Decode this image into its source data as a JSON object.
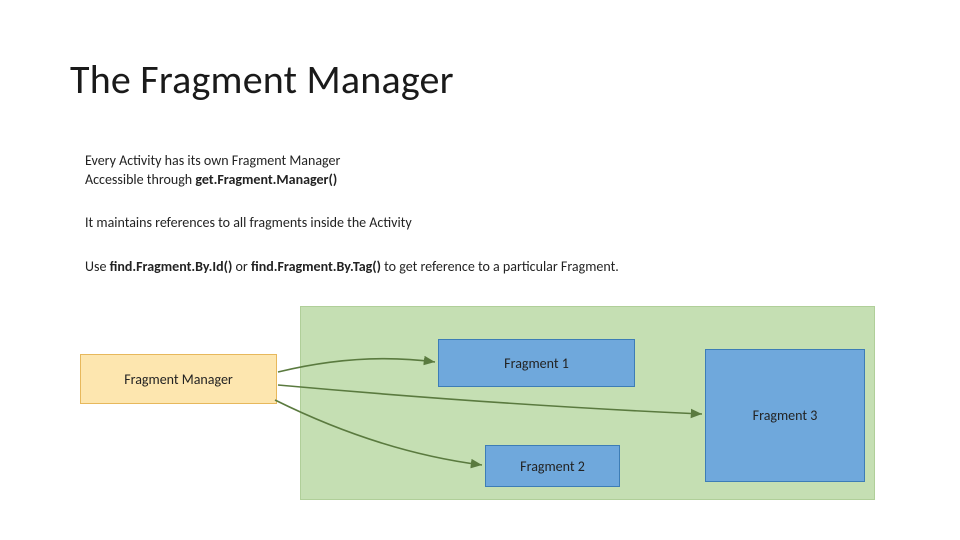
{
  "title": "The Fragment Manager",
  "text": {
    "line1": "Every Activity has its own Fragment Manager",
    "line2_pre": "Accessible through ",
    "line2_bold": "get.Fragment.Manager()",
    "line3": "It maintains references to all fragments inside the Activity",
    "line4_pre": "Use ",
    "line4_b1": "find.Fragment.By.Id()",
    "line4_mid": " or ",
    "line4_b2": "find.Fragment.By.Tag()",
    "line4_post": " to get reference to a particular Fragment."
  },
  "boxes": {
    "manager": "Fragment Manager",
    "frag1": "Fragment 1",
    "frag2": "Fragment 2",
    "frag3": "Fragment 3"
  }
}
